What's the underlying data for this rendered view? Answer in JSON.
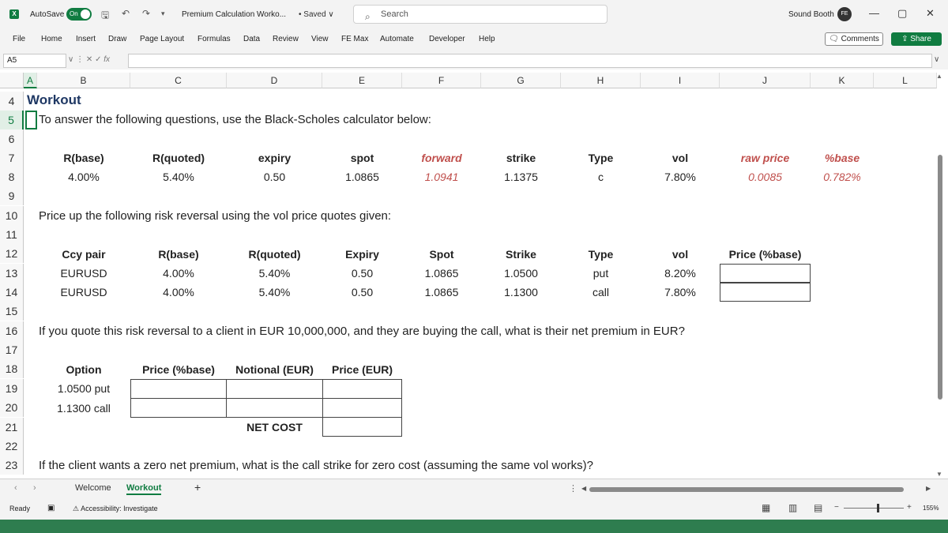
{
  "titlebar": {
    "logo": "X",
    "autosave_label": "AutoSave",
    "autosave_state": "On",
    "doc_title": "Premium Calculation Worko...",
    "saved_status": "• Saved ∨",
    "search_placeholder": "Search",
    "user_name": "Sound Booth",
    "avatar_initials": "FE"
  },
  "ribbon": {
    "tabs": [
      "File",
      "Home",
      "Insert",
      "Draw",
      "Page Layout",
      "Formulas",
      "Data",
      "Review",
      "View",
      "FE Max",
      "Automate",
      "Developer",
      "Help"
    ],
    "comments_label": "Comments",
    "share_label": "Share"
  },
  "formula_bar": {
    "name_box": "A5",
    "fx_label": "fx",
    "formula": ""
  },
  "grid": {
    "columns": [
      "A",
      "B",
      "C",
      "D",
      "E",
      "F",
      "G",
      "H",
      "I",
      "J",
      "K",
      "L"
    ],
    "rows": [
      "4",
      "5",
      "6",
      "7",
      "8",
      "9",
      "10",
      "11",
      "12",
      "13",
      "14",
      "15",
      "16",
      "17",
      "18",
      "19",
      "20",
      "21",
      "22",
      "23"
    ]
  },
  "sheet": {
    "title": "Workout",
    "intro": "To answer the following questions, use the Black-Scholes calculator below:",
    "calc": {
      "headers": [
        "R(base)",
        "R(quoted)",
        "expiry",
        "spot",
        "forward",
        "strike",
        "Type",
        "vol",
        "raw price",
        "%base"
      ],
      "values": [
        "4.00%",
        "5.40%",
        "0.50",
        "1.0865",
        "1.0941",
        "1.1375",
        "c",
        "7.80%",
        "0.0085",
        "0.782%"
      ]
    },
    "rr_prompt": "Price up the following risk reversal using the vol price quotes given:",
    "rr": {
      "headers": [
        "Ccy pair",
        "R(base)",
        "R(quoted)",
        "Expiry",
        "Spot",
        "Strike",
        "Type",
        "vol",
        "Price (%base)"
      ],
      "rows": [
        [
          "EURUSD",
          "4.00%",
          "5.40%",
          "0.50",
          "1.0865",
          "1.0500",
          "put",
          "8.20%"
        ],
        [
          "EURUSD",
          "4.00%",
          "5.40%",
          "0.50",
          "1.0865",
          "1.1300",
          "call",
          "7.80%"
        ]
      ]
    },
    "q2": "If you quote this risk reversal to a client in EUR 10,000,000, and they are buying the call, what is their net premium in EUR?",
    "premium": {
      "headers": [
        "Option",
        "Price (%base)",
        "Notional (EUR)",
        "Price (EUR)"
      ],
      "rows": [
        "1.0500 put",
        "1.1300 call"
      ],
      "net_cost_label": "NET COST"
    },
    "q3": "If the client wants a zero net premium, what is the call strike for zero cost (assuming the same vol works)?"
  },
  "sheet_tabs": {
    "tabs": [
      "Welcome",
      "Workout"
    ],
    "active": "Workout",
    "add_label": "+"
  },
  "status": {
    "ready": "Ready",
    "accessibility": "Accessibility: Investigate",
    "zoom": "155%"
  },
  "colors": {
    "accent": "#107c41",
    "title": "#1f3864",
    "forward_red": "#c0504d"
  }
}
